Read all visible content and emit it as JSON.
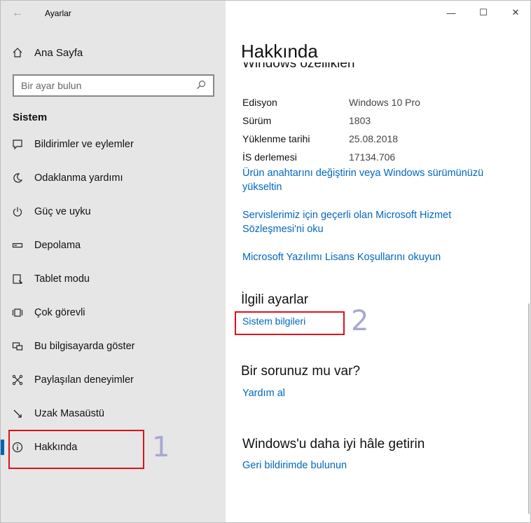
{
  "window": {
    "title": "Ayarlar"
  },
  "sidebar": {
    "home_label": "Ana Sayfa",
    "search_placeholder": "Bir ayar bulun",
    "section_title": "Sistem",
    "items": [
      {
        "label": "Bildirimler ve eylemler",
        "icon": "notification-icon"
      },
      {
        "label": "Odaklanma yardımı",
        "icon": "moon-icon"
      },
      {
        "label": "Güç ve uyku",
        "icon": "power-icon"
      },
      {
        "label": "Depolama",
        "icon": "storage-icon"
      },
      {
        "label": "Tablet modu",
        "icon": "tablet-icon"
      },
      {
        "label": "Çok görevli",
        "icon": "multitask-icon"
      },
      {
        "label": "Bu bilgisayarda göster",
        "icon": "project-icon"
      },
      {
        "label": "Paylaşılan deneyimler",
        "icon": "share-icon"
      },
      {
        "label": "Uzak Masaüstü",
        "icon": "remote-desktop-icon"
      },
      {
        "label": "Hakkında",
        "icon": "info-icon",
        "active": true
      }
    ]
  },
  "main": {
    "page_title": "Hakkında",
    "clipped_heading": "Windows özellikleri",
    "specs": [
      {
        "key": "Edisyon",
        "value": "Windows 10 Pro"
      },
      {
        "key": "Sürüm",
        "value": "1803"
      },
      {
        "key": "Yüklenme tarihi",
        "value": "25.08.2018"
      },
      {
        "key": "İS derlemesi",
        "value": "17134.706"
      }
    ],
    "links": {
      "product_key_1": "Ürün anahtarını değiştirin veya Windows sürümünüzü",
      "product_key_2": "yükseltin",
      "services_1": "Servislerimiz için geçerli olan Microsoft Hizmet",
      "services_2": "Sözleşmesi'ni oku",
      "license": "Microsoft Yazılımı Lisans Koşullarını okuyun"
    },
    "related_title": "İlgili ayarlar",
    "related_link": "Sistem bilgileri",
    "question_title": "Bir sorunuz mu var?",
    "help_link": "Yardım al",
    "improve_title": "Windows'u daha iyi hâle getirin",
    "feedback_link": "Geri bildirimde bulunun"
  },
  "annotations": {
    "one": "1",
    "two": "2"
  },
  "colors": {
    "accent": "#0063b1",
    "link": "#0067c0",
    "highlight": "#e0101a"
  }
}
